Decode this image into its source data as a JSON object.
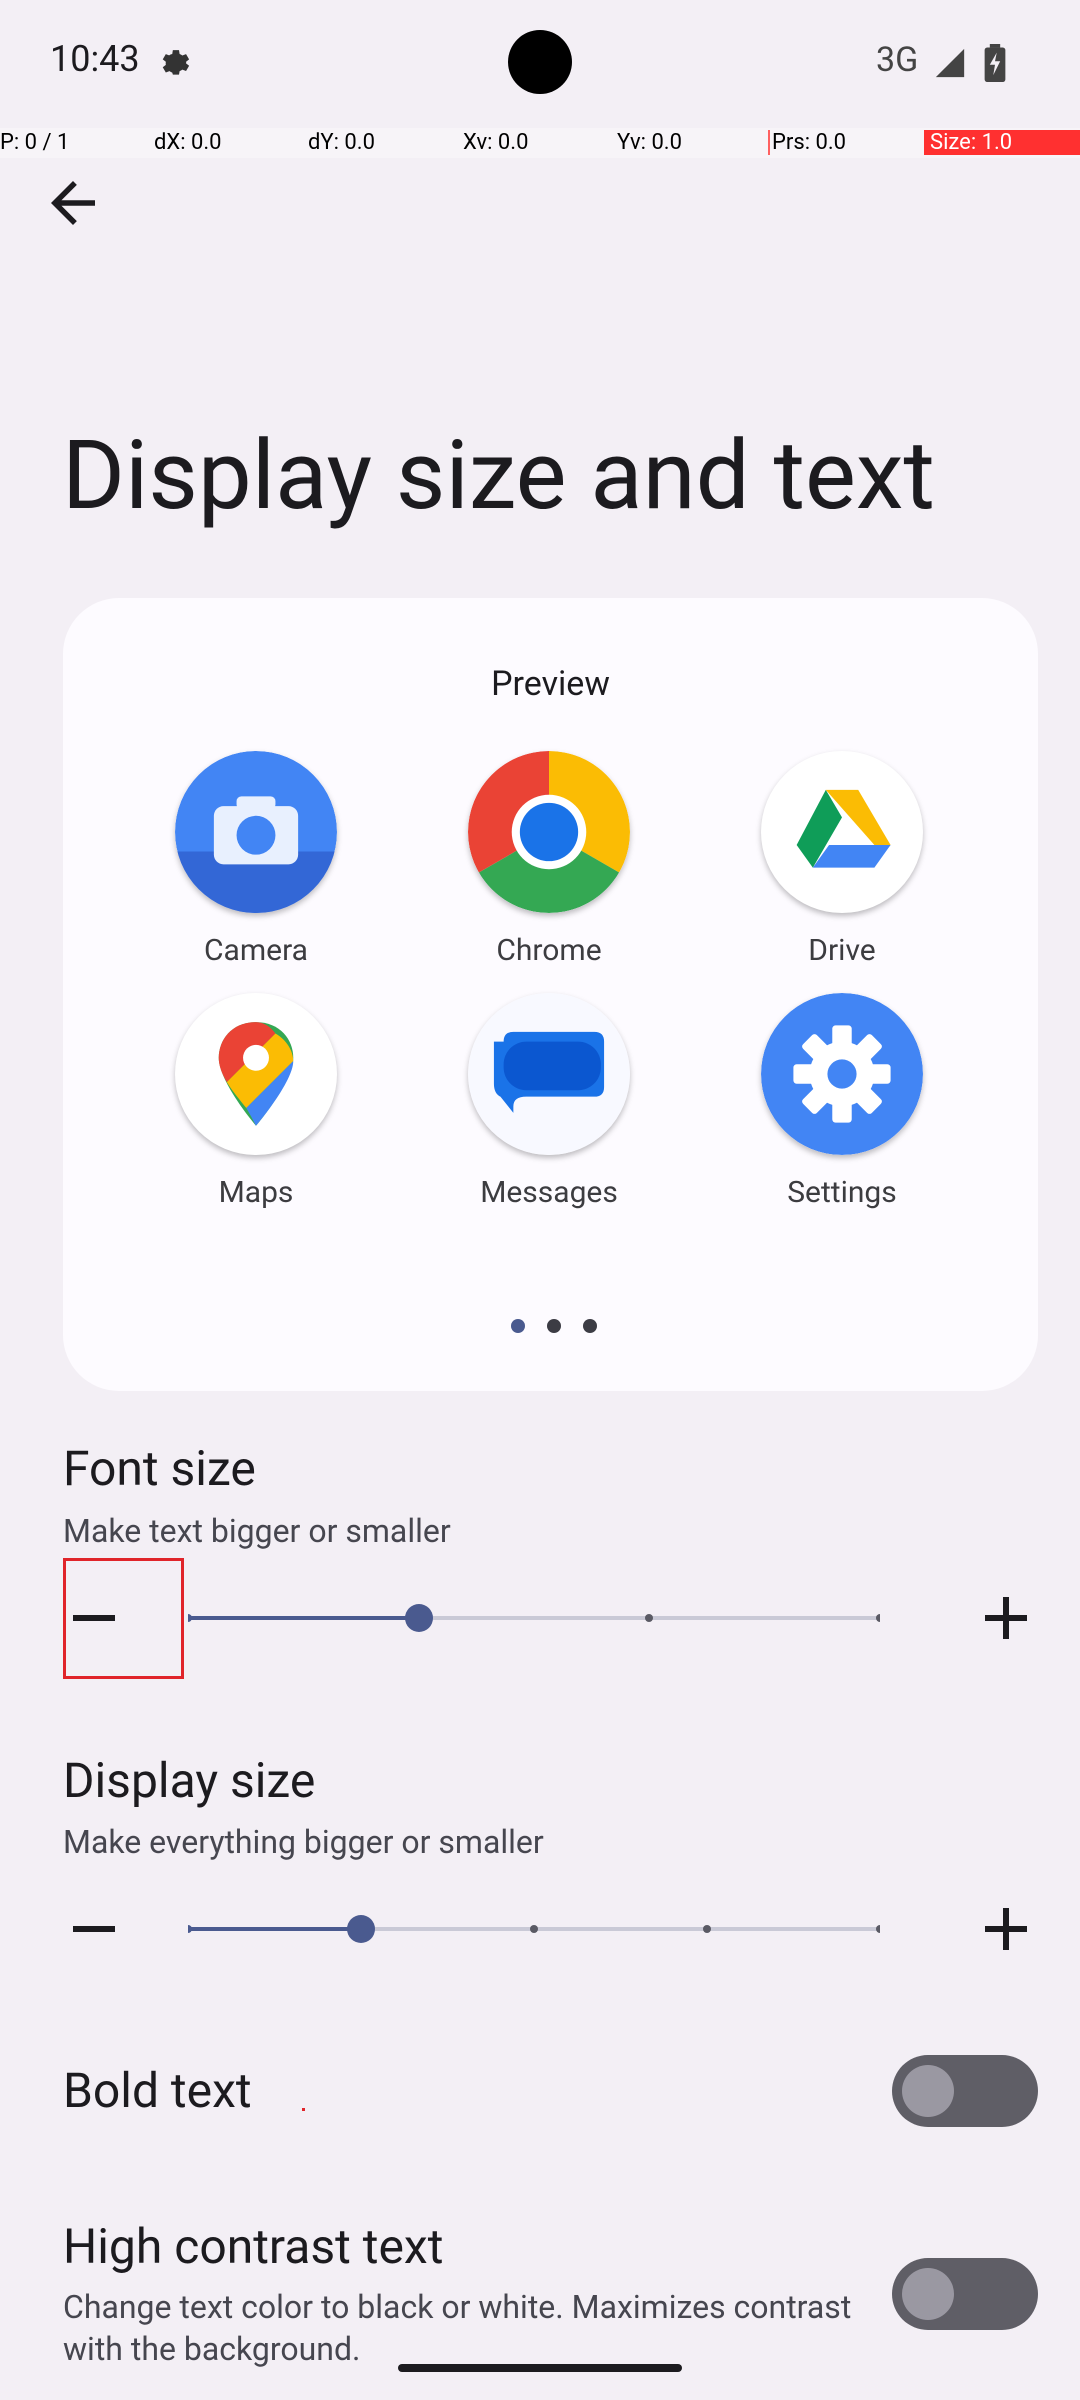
{
  "status_bar": {
    "time": "10:43",
    "network": "3G",
    "icons": [
      "settings-gear-icon",
      "signal-icon",
      "battery-icon"
    ]
  },
  "pointer_overlay": {
    "p": "P: 0 / 1",
    "dx": "dX: 0.0",
    "dy": "dY: 0.0",
    "xv": "Xv: 0.0",
    "yv": "Yv: 0.0",
    "prs": "Prs: 0.0",
    "size": "Size: 1.0"
  },
  "toolbar": {
    "back_icon": "arrow-back-icon"
  },
  "page_title": "Display size and text",
  "preview": {
    "label": "Preview",
    "apps": [
      {
        "label": "Camera",
        "icon": "camera-icon"
      },
      {
        "label": "Chrome",
        "icon": "chrome-icon"
      },
      {
        "label": "Drive",
        "icon": "drive-icon"
      },
      {
        "label": "Maps",
        "icon": "maps-icon"
      },
      {
        "label": "Messages",
        "icon": "messages-icon"
      },
      {
        "label": "Settings",
        "icon": "settings-icon"
      }
    ],
    "page_indicator": {
      "pages": 3,
      "current": 1
    }
  },
  "font_size": {
    "title": "Font size",
    "subtitle": "Make text bigger or smaller",
    "steps": 4,
    "value_index": 1
  },
  "display_size": {
    "title": "Display size",
    "subtitle": "Make everything bigger or smaller",
    "steps": 5,
    "value_index": 1
  },
  "bold_text": {
    "title": "Bold text",
    "enabled": false
  },
  "high_contrast": {
    "title": "High contrast text",
    "subtitle": "Change text color to black or white. Maximizes contrast with the background.",
    "enabled": false
  },
  "colors": {
    "accent": "#4a5a8f",
    "track_inactive": "#c9c9d6",
    "toggle_off": "#5f5e66",
    "focus": "#e0242a"
  }
}
